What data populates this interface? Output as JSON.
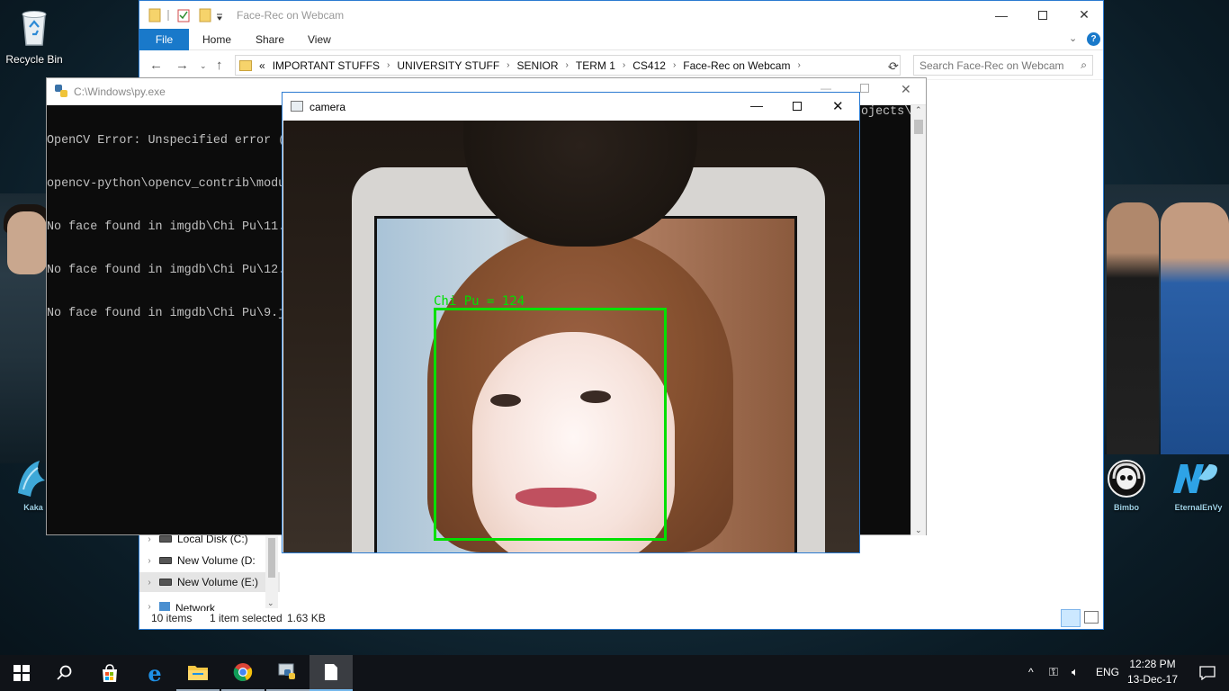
{
  "desktop": {
    "recycle_bin_label": "Recycle Bin",
    "left_icon_label": "Kaka",
    "right_icon_1_label": "Bimbo",
    "right_icon_2_label": "EternalEnVy"
  },
  "explorer": {
    "title": "Face-Rec on Webcam",
    "tabs": [
      "File",
      "Home",
      "Share",
      "View"
    ],
    "breadcrumb": [
      "IMPORTANT STUFFS",
      "UNIVERSITY STUFF",
      "SENIOR",
      "TERM 1",
      "CS412",
      "Face-Rec on Webcam"
    ],
    "breadcrumb_overflow": "«",
    "search_placeholder": "Search Face-Rec on Webcam",
    "tree": [
      "Local Disk (C:)",
      "New Volume (D:",
      "New Volume (E:)",
      "Network"
    ],
    "status": {
      "items": "10 items",
      "selection": "1 item selected",
      "size": "1.63 KB"
    }
  },
  "console": {
    "title": "C:\\Windows\\py.exe",
    "lines": [
      "OpenCV Error: Unspecified error (",
      "opencv-python\\opencv_contrib\\modu",
      "No face found in imgdb\\Chi Pu\\11.",
      "No face found in imgdb\\Chi Pu\\12.",
      "No face found in imgdb\\Chi Pu\\9.j"
    ],
    "right_fragment": "ojects\\"
  },
  "camera": {
    "title": "camera",
    "detection_label": "Chi Pu = 124"
  },
  "taskbar": {
    "time": "12:28 PM",
    "date": "13-Dec-17",
    "language": "ENG",
    "colors": {
      "background": "#101318",
      "active_underline": "#76b9ed"
    }
  },
  "colors": {
    "explorer_accent": "#1979ca",
    "detection_box": "#00e000"
  }
}
